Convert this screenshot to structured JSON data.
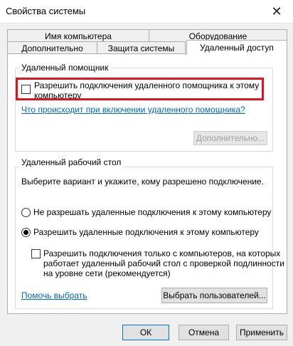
{
  "window": {
    "title": "Свойства системы",
    "close_glyph": "✕"
  },
  "tabs": {
    "row1": [
      {
        "label": "Имя компьютера"
      },
      {
        "label": "Оборудование"
      }
    ],
    "row2": [
      {
        "label": "Дополнительно"
      },
      {
        "label": "Защита системы"
      },
      {
        "label": "Удаленный доступ",
        "selected": true
      }
    ]
  },
  "remote_assistance": {
    "group_title": "Удаленный помощник",
    "allow_checkbox": {
      "label_line1": "Разрешить подключения удаленного помощника к этому",
      "label_line2": "компьютеру",
      "checked": false
    },
    "help_link": "Что происходит при включении удаленного помощника?",
    "advanced_button": "Дополнительно...",
    "advanced_enabled": false
  },
  "remote_desktop": {
    "group_title": "Удаленный рабочий стол",
    "instruction": "Выберите вариант и укажите, кому разрешено подключение.",
    "option_deny": {
      "label": "Не разрешать удаленные подключения к этому компьютеру",
      "selected": false
    },
    "option_allow": {
      "label": "Разрешить удаленные подключения к этому компьютеру",
      "selected": true
    },
    "nla_checkbox": {
      "line1": "Разрешить подключения только с компьютеров, на которых",
      "line2": "работает удаленный рабочий стол с проверкой подлинности",
      "line3": "на уровне сети (рекомендуется)",
      "checked": false
    },
    "help_link": "Помочь выбрать",
    "select_users_button": "Выбрать пользователей..."
  },
  "footer": {
    "ok": "ОК",
    "cancel": "Отмена",
    "apply": "Применить"
  },
  "colors": {
    "highlight_border": "#e0141e",
    "link": "#0066cc",
    "default_button_border": "#0078d7"
  }
}
